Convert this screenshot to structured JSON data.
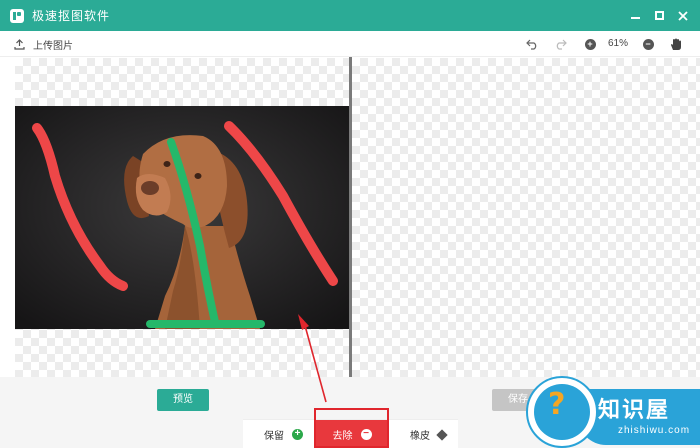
{
  "app": {
    "title": "极速抠图软件",
    "icon": "app-logo-icon",
    "accent_color": "#2bab96"
  },
  "window_controls": [
    "minimize-icon",
    "maximize-icon",
    "close-icon"
  ],
  "toolbar": {
    "upload_label": "上传图片",
    "upload_icon": "upload-icon",
    "undo_icon": "undo-icon",
    "redo_icon": "redo-icon",
    "zoom_in_icon": "zoom-in-icon",
    "zoom_level": "61%",
    "zoom_out_icon": "zoom-out-icon",
    "pan_icon": "hand-icon"
  },
  "canvas": {
    "left_panel": "original image with brush strokes",
    "right_panel": "transparent result preview",
    "stroke_colors": {
      "keep": "#25b86a",
      "remove": "#ee4748"
    }
  },
  "actions": {
    "preview_label": "预览",
    "save_label": "保存"
  },
  "modes": {
    "keep_label": "保留",
    "keep_icon": "plus-circle-icon",
    "remove_label": "去除",
    "remove_icon": "minus-circle-icon",
    "remove_color": "#e8383d",
    "eraser_label": "橡皮",
    "eraser_icon": "eraser-icon",
    "active": "remove"
  },
  "watermark": {
    "brand": "知识屋",
    "domain": "zhishiwu.com"
  }
}
